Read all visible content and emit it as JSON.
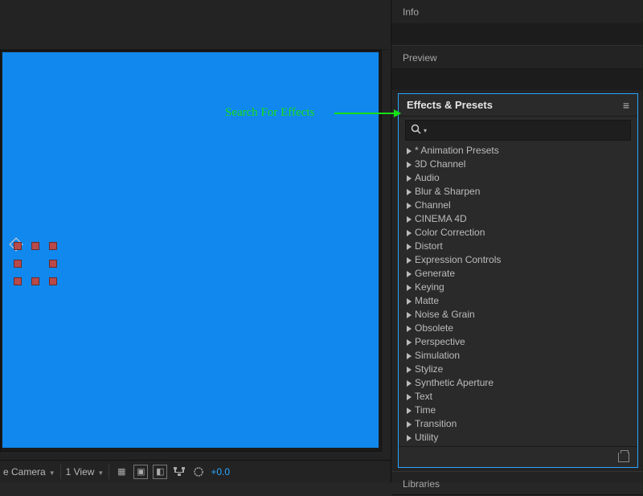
{
  "annotation": {
    "text": "Search For Effects"
  },
  "panels": {
    "info_label": "Info",
    "preview_label": "Preview",
    "effects_label": "Effects & Presets",
    "libraries_label": "Libraries"
  },
  "effects": {
    "categories": [
      "* Animation Presets",
      "3D Channel",
      "Audio",
      "Blur & Sharpen",
      "Channel",
      "CINEMA 4D",
      "Color Correction",
      "Distort",
      "Expression Controls",
      "Generate",
      "Keying",
      "Matte",
      "Noise & Grain",
      "Obsolete",
      "Perspective",
      "Simulation",
      "Stylize",
      "Synthetic Aperture",
      "Text",
      "Time",
      "Transition",
      "Utility"
    ]
  },
  "status": {
    "camera": "e Camera",
    "view": "1 View",
    "exposure": "+0.0"
  },
  "colors": {
    "canvas_bg": "#1188ee",
    "highlight": "#2aa6ff",
    "handle": "#b84a4a"
  }
}
